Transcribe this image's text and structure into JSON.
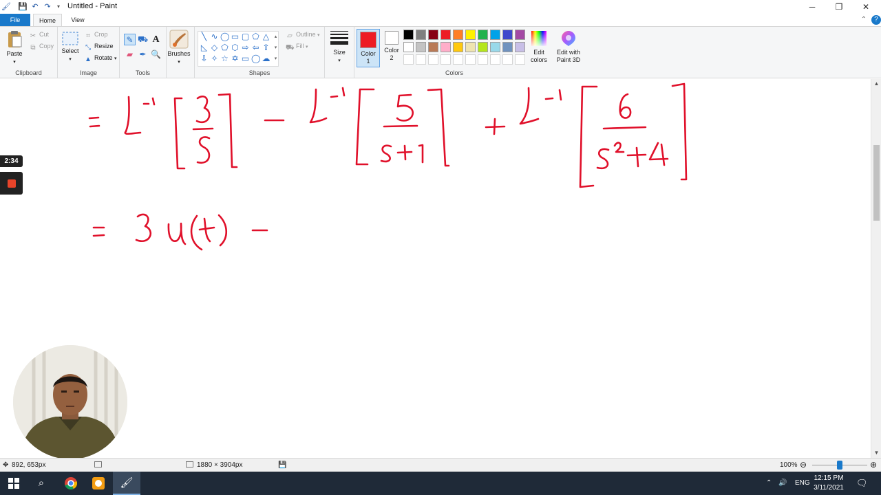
{
  "window": {
    "title": "Untitled - Paint",
    "minimize": "─",
    "maximize": "❐",
    "close": "✕"
  },
  "quick_access": {
    "save_icon": "save-icon",
    "undo_icon": "undo-icon",
    "redo_icon": "redo-icon"
  },
  "tabs": {
    "file": "File",
    "home": "Home",
    "view": "View"
  },
  "ribbon": {
    "clipboard": {
      "label": "Clipboard",
      "paste": "Paste",
      "cut": "Cut",
      "copy": "Copy"
    },
    "image": {
      "label": "Image",
      "select": "Select",
      "crop": "Crop",
      "resize": "Resize",
      "rotate": "Rotate"
    },
    "tools": {
      "label": "Tools",
      "brushes": "Brushes"
    },
    "shapes": {
      "label": "Shapes",
      "outline": "Outline",
      "fill": "Fill"
    },
    "size": {
      "label": "Size"
    },
    "colors": {
      "label": "Colors",
      "color1_line1": "Color",
      "color1_line2": "1",
      "color2_line1": "Color",
      "color2_line2": "2",
      "edit_colors_line1": "Edit",
      "edit_colors_line2": "colors",
      "paint3d_line1": "Edit with",
      "paint3d_line2": "Paint 3D",
      "color1_value": "#ed1c24",
      "color2_value": "#ffffff",
      "palette_row1": [
        "#000000",
        "#7f7f7f",
        "#880015",
        "#ed1c24",
        "#ff7f27",
        "#fff200",
        "#22b14c",
        "#00a2e8",
        "#3f48cc",
        "#a349a4"
      ],
      "palette_row2": [
        "#ffffff",
        "#c3c3c3",
        "#b97a57",
        "#ffaec9",
        "#ffc90e",
        "#efe4b0",
        "#b5e61d",
        "#99d9ea",
        "#7092be",
        "#c8bfe7"
      ]
    }
  },
  "recording": {
    "timer": "2:34"
  },
  "status": {
    "cursor_pos": "892, 653px",
    "canvas_size": "1880 × 3904px",
    "zoom": "100%",
    "zoom_level": 0.5
  },
  "taskbar": {
    "lang": "ENG",
    "time": "12:15 PM",
    "date": "3/11/2021"
  }
}
